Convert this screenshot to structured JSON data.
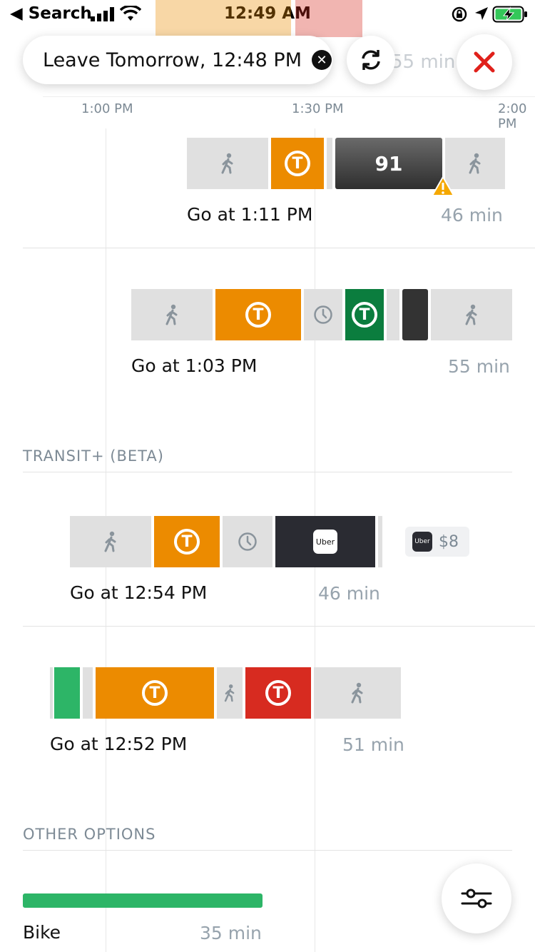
{
  "status_bar": {
    "back_label": "◀ Search",
    "time": "12:49 AM"
  },
  "header": {
    "leave_label": "Leave Tomorrow, 12:48 PM",
    "clear_icon": "x-circle-icon",
    "refresh_icon": "refresh-icon",
    "close_icon": "close-icon",
    "ghost_duration": "55 min"
  },
  "timeline": {
    "ticks": [
      "1:00 PM",
      "1:30 PM",
      "2:00 PM"
    ]
  },
  "routes": [
    {
      "go": "Go at 1:11 PM",
      "duration": "46 min",
      "bus_number": "91",
      "has_alert": true
    },
    {
      "go": "Go at 1:03 PM",
      "duration": "55 min"
    }
  ],
  "transit_plus": {
    "section_label": "TRANSIT+ (BETA)",
    "routes": [
      {
        "go": "Go at 12:54 PM",
        "duration": "46 min",
        "uber_label": "Uber",
        "price": "$8"
      },
      {
        "go": "Go at 12:52 PM",
        "duration": "51 min"
      }
    ]
  },
  "other": {
    "section_label": "OTHER OPTIONS",
    "bike_label": "Bike",
    "bike_duration": "35 min"
  },
  "colors": {
    "orange_line": "#ec8b00",
    "green_line": "#0b7d3e",
    "red_line": "#d72b20",
    "bike": "#2db567",
    "close_x": "#e0211b"
  }
}
